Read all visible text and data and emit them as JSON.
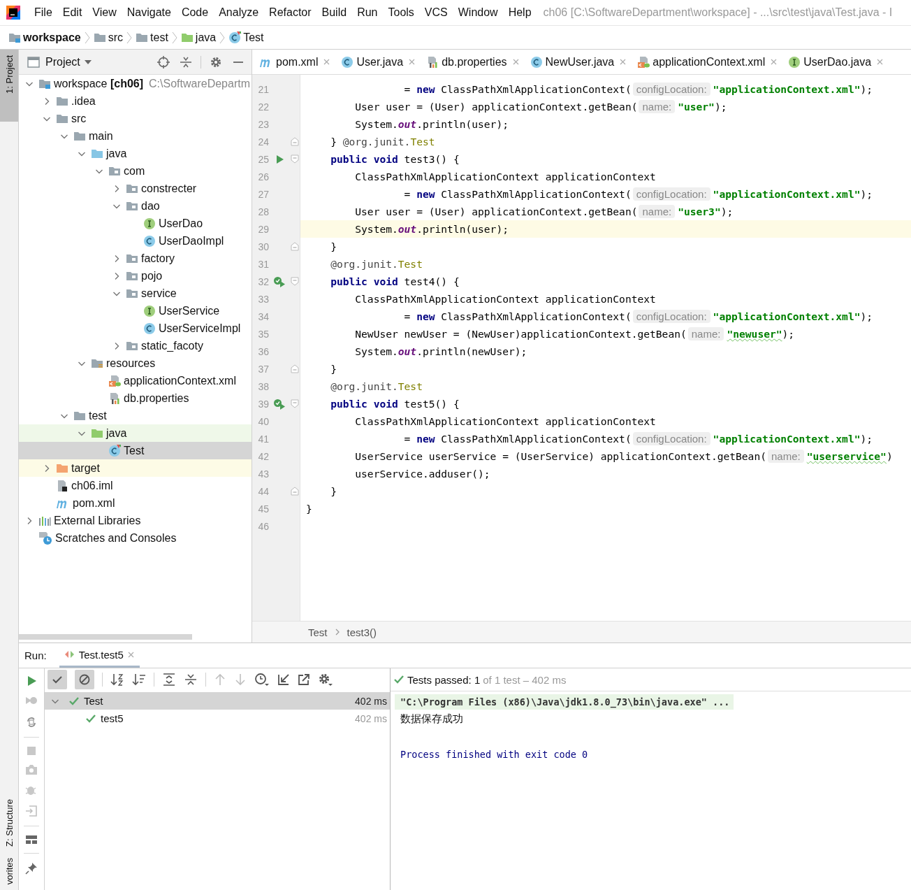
{
  "menu": [
    "File",
    "Edit",
    "View",
    "Navigate",
    "Code",
    "Analyze",
    "Refactor",
    "Build",
    "Run",
    "Tools",
    "VCS",
    "Window",
    "Help"
  ],
  "window_title": "ch06 [C:\\SoftwareDepartment\\workspace] - ...\\src\\test\\java\\Test.java - I",
  "navigation_bar": [
    {
      "label": "workspace",
      "kind": "module"
    },
    {
      "label": "src",
      "kind": "folder"
    },
    {
      "label": "test",
      "kind": "folder"
    },
    {
      "label": "java",
      "kind": "test-root"
    },
    {
      "label": "Test",
      "kind": "test-class"
    }
  ],
  "tool_strip": [
    {
      "label": "1: Project",
      "selected": true
    },
    {
      "label": "Z: Structure",
      "selected": false
    },
    {
      "label": "vorites",
      "selected": false
    }
  ],
  "project": {
    "title": "Project",
    "tree": [
      {
        "label": "workspace **[ch06]**",
        "path": "C:\\SoftwareDepartm",
        "kind": "module",
        "expanded": true,
        "selected": false,
        "children": [
          {
            "label": ".idea",
            "kind": "folder",
            "expanded": false,
            "selected": false
          },
          {
            "label": "src",
            "kind": "folder",
            "expanded": true,
            "selected": false,
            "children": [
              {
                "label": "main",
                "kind": "folder",
                "expanded": true,
                "selected": false,
                "children": [
                  {
                    "label": "java",
                    "kind": "source-root",
                    "expanded": true,
                    "selected": false,
                    "children": [
                      {
                        "label": "com",
                        "kind": "package",
                        "expanded": true,
                        "selected": false,
                        "children": [
                          {
                            "label": "constrecter",
                            "kind": "package",
                            "expanded": false,
                            "selected": false
                          },
                          {
                            "label": "dao",
                            "kind": "package",
                            "expanded": true,
                            "selected": false,
                            "children": [
                              {
                                "label": "UserDao",
                                "kind": "interface",
                                "selected": false
                              },
                              {
                                "label": "UserDaoImpl",
                                "kind": "class",
                                "selected": false
                              }
                            ]
                          },
                          {
                            "label": "factory",
                            "kind": "package",
                            "expanded": false,
                            "selected": false
                          },
                          {
                            "label": "pojo",
                            "kind": "package",
                            "expanded": false,
                            "selected": false
                          },
                          {
                            "label": "service",
                            "kind": "package",
                            "expanded": true,
                            "selected": false,
                            "children": [
                              {
                                "label": "UserService",
                                "kind": "interface",
                                "selected": false
                              },
                              {
                                "label": "UserServiceImpl",
                                "kind": "class",
                                "selected": false
                              }
                            ]
                          },
                          {
                            "label": "static_facoty",
                            "kind": "package",
                            "expanded": false,
                            "selected": false
                          }
                        ]
                      }
                    ]
                  },
                  {
                    "label": "resources",
                    "kind": "resources",
                    "expanded": true,
                    "selected": false,
                    "children": [
                      {
                        "label": "applicationContext.xml",
                        "kind": "xml-config",
                        "selected": false
                      },
                      {
                        "label": "db.properties",
                        "kind": "properties",
                        "selected": false
                      }
                    ]
                  }
                ]
              },
              {
                "label": "test",
                "kind": "folder",
                "expanded": true,
                "selected": false,
                "children": [
                  {
                    "label": "java",
                    "kind": "test-root",
                    "expanded": true,
                    "selected": false,
                    "color": "#eff8e9",
                    "children": [
                      {
                        "label": "Test",
                        "kind": "test-class",
                        "selected": true
                      }
                    ]
                  }
                ]
              }
            ]
          },
          {
            "label": "target",
            "kind": "excluded",
            "expanded": false,
            "selected": false,
            "color": "#fdfbe6"
          },
          {
            "label": "ch06.iml",
            "kind": "iml",
            "selected": false
          },
          {
            "label": "pom.xml",
            "kind": "maven",
            "selected": false
          }
        ]
      },
      {
        "label": "External Libraries",
        "kind": "libraries",
        "expanded": false,
        "selected": false
      },
      {
        "label": "Scratches and Consoles",
        "kind": "scratches",
        "selected": false
      }
    ]
  },
  "editor_tabs": [
    {
      "label": "pom.xml",
      "kind": "maven",
      "selected": false
    },
    {
      "label": "User.java",
      "kind": "class",
      "selected": false
    },
    {
      "label": "db.properties",
      "kind": "properties",
      "selected": false
    },
    {
      "label": "NewUser.java",
      "kind": "class",
      "selected": false
    },
    {
      "label": "applicationContext.xml",
      "kind": "xml-config",
      "selected": false
    },
    {
      "label": "UserDao.java",
      "kind": "interface",
      "selected": false
    }
  ],
  "code": [
    {
      "number": "21",
      "current": false,
      "tokens": [
        {
          "kind": "plain",
          "text": "                = "
        },
        {
          "kind": "keyword",
          "text": "new"
        },
        {
          "kind": "plain",
          "text": " ClassPathXmlApplicationContext("
        },
        {
          "kind": "hint",
          "text": "configLocation:"
        },
        {
          "kind": "string",
          "text": "\"applicationContext.xml\""
        },
        {
          "kind": "plain",
          "text": ");"
        }
      ]
    },
    {
      "number": "22",
      "current": false,
      "tokens": [
        {
          "kind": "plain",
          "text": "        User user = (User) applicationContext.getBean("
        },
        {
          "kind": "hint",
          "text": "name:"
        },
        {
          "kind": "string",
          "text": "\"user\""
        },
        {
          "kind": "plain",
          "text": ");"
        }
      ]
    },
    {
      "number": "23",
      "current": false,
      "tokens": [
        {
          "kind": "plain",
          "text": "        System."
        },
        {
          "kind": "field",
          "text": "out"
        },
        {
          "kind": "plain",
          "text": ".println(user);"
        }
      ]
    },
    {
      "number": "24",
      "current": false,
      "gutter_icons": [
        {
          "kind": "fold-end"
        }
      ],
      "tokens": [
        {
          "kind": "plain",
          "text": "    } "
        },
        {
          "kind": "annotation",
          "text": "@org.junit."
        },
        {
          "kind": "annotation-name",
          "text": "Test"
        }
      ]
    },
    {
      "number": "25",
      "current": false,
      "gutter_icons": [
        {
          "kind": "run"
        },
        {
          "kind": "fold-start"
        }
      ],
      "tokens": [
        {
          "kind": "keyword",
          "text": "    public"
        },
        {
          "kind": "keyword",
          "text": " void"
        },
        {
          "kind": "plain",
          "text": " test3() {"
        }
      ]
    },
    {
      "number": "26",
      "current": false,
      "tokens": [
        {
          "kind": "plain",
          "text": "        ClassPathXmlApplicationContext applicationContext"
        }
      ]
    },
    {
      "number": "27",
      "current": false,
      "tokens": [
        {
          "kind": "plain",
          "text": "                = "
        },
        {
          "kind": "keyword",
          "text": "new"
        },
        {
          "kind": "plain",
          "text": " ClassPathXmlApplicationContext("
        },
        {
          "kind": "hint",
          "text": "configLocation:"
        },
        {
          "kind": "string",
          "text": "\"applicationContext.xml\""
        },
        {
          "kind": "plain",
          "text": ");"
        }
      ]
    },
    {
      "number": "28",
      "current": false,
      "tokens": [
        {
          "kind": "plain",
          "text": "        User user = (User) applicationContext.getBean("
        },
        {
          "kind": "hint",
          "text": "name:"
        },
        {
          "kind": "string",
          "text": "\"user3\""
        },
        {
          "kind": "plain",
          "text": ");"
        }
      ]
    },
    {
      "number": "29",
      "current": true,
      "tokens": [
        {
          "kind": "plain",
          "text": "        System."
        },
        {
          "kind": "field",
          "text": "out"
        },
        {
          "kind": "plain",
          "text": ".println(user);"
        }
      ]
    },
    {
      "number": "30",
      "current": false,
      "gutter_icons": [
        {
          "kind": "fold-end"
        }
      ],
      "tokens": [
        {
          "kind": "plain",
          "text": "    }"
        }
      ]
    },
    {
      "number": "31",
      "current": false,
      "tokens": [
        {
          "kind": "annotation",
          "text": "    @org.junit."
        },
        {
          "kind": "annotation-name",
          "text": "Test"
        }
      ]
    },
    {
      "number": "32",
      "current": false,
      "gutter_icons": [
        {
          "kind": "run-passed"
        },
        {
          "kind": "fold-start"
        }
      ],
      "tokens": [
        {
          "kind": "keyword",
          "text": "    public"
        },
        {
          "kind": "keyword",
          "text": " void"
        },
        {
          "kind": "plain",
          "text": " test4() {"
        }
      ]
    },
    {
      "number": "33",
      "current": false,
      "tokens": [
        {
          "kind": "plain",
          "text": "        ClassPathXmlApplicationContext applicationContext"
        }
      ]
    },
    {
      "number": "34",
      "current": false,
      "tokens": [
        {
          "kind": "plain",
          "text": "                = "
        },
        {
          "kind": "keyword",
          "text": "new"
        },
        {
          "kind": "plain",
          "text": " ClassPathXmlApplicationContext("
        },
        {
          "kind": "hint",
          "text": "configLocation:"
        },
        {
          "kind": "string",
          "text": "\"applicationContext.xml\""
        },
        {
          "kind": "plain",
          "text": ");"
        }
      ]
    },
    {
      "number": "35",
      "current": false,
      "tokens": [
        {
          "kind": "plain",
          "text": "        NewUser newUser = (NewUser)applicationContext.getBean("
        },
        {
          "kind": "hint",
          "text": "name:"
        },
        {
          "kind": "string-typo",
          "text": "\"newuser\""
        },
        {
          "kind": "plain",
          "text": ");"
        }
      ]
    },
    {
      "number": "36",
      "current": false,
      "tokens": [
        {
          "kind": "plain",
          "text": "        System."
        },
        {
          "kind": "field",
          "text": "out"
        },
        {
          "kind": "plain",
          "text": ".println(newUser);"
        }
      ]
    },
    {
      "number": "37",
      "current": false,
      "gutter_icons": [
        {
          "kind": "fold-end"
        }
      ],
      "tokens": [
        {
          "kind": "plain",
          "text": "    }"
        }
      ]
    },
    {
      "number": "38",
      "current": false,
      "tokens": [
        {
          "kind": "annotation",
          "text": "    @org.junit."
        },
        {
          "kind": "annotation-name",
          "text": "Test"
        }
      ]
    },
    {
      "number": "39",
      "current": false,
      "gutter_icons": [
        {
          "kind": "run-passed"
        },
        {
          "kind": "fold-start"
        }
      ],
      "tokens": [
        {
          "kind": "keyword",
          "text": "    public"
        },
        {
          "kind": "keyword",
          "text": " void"
        },
        {
          "kind": "plain",
          "text": " test5() {"
        }
      ]
    },
    {
      "number": "40",
      "current": false,
      "tokens": [
        {
          "kind": "plain",
          "text": "        ClassPathXmlApplicationContext applicationContext"
        }
      ]
    },
    {
      "number": "41",
      "current": false,
      "tokens": [
        {
          "kind": "plain",
          "text": "                = "
        },
        {
          "kind": "keyword",
          "text": "new"
        },
        {
          "kind": "plain",
          "text": " ClassPathXmlApplicationContext("
        },
        {
          "kind": "hint",
          "text": "configLocation:"
        },
        {
          "kind": "string",
          "text": "\"applicationContext.xml\""
        },
        {
          "kind": "plain",
          "text": ");"
        }
      ]
    },
    {
      "number": "42",
      "current": false,
      "tokens": [
        {
          "kind": "plain",
          "text": "        UserService userService = (UserService) applicationContext.getBean("
        },
        {
          "kind": "hint",
          "text": "name:"
        },
        {
          "kind": "string-typo",
          "text": "\"userservice\""
        },
        {
          "kind": "plain",
          "text": ")"
        }
      ]
    },
    {
      "number": "43",
      "current": false,
      "tokens": [
        {
          "kind": "plain",
          "text": "        userService.adduser();"
        }
      ]
    },
    {
      "number": "44",
      "current": false,
      "gutter_icons": [
        {
          "kind": "fold-end"
        }
      ],
      "tokens": [
        {
          "kind": "plain",
          "text": "    }"
        }
      ]
    },
    {
      "number": "45",
      "current": false,
      "tokens": [
        {
          "kind": "plain",
          "text": "}"
        }
      ]
    },
    {
      "number": "46",
      "current": false
    }
  ],
  "editor_breadcrumbs": [
    "Test",
    "test3()"
  ],
  "run": {
    "label": "Run:",
    "tab": {
      "label": "Test.test5",
      "selected": true
    },
    "toggles": [
      {
        "on": true
      },
      {
        "on": true
      }
    ],
    "status": {
      "main": "Tests passed: 1",
      "detail": "of 1 test – 402 ms"
    },
    "tests": [
      {
        "label": "Test",
        "time": "402 ms",
        "expanded": true,
        "selected": true,
        "children": [
          {
            "label": "test5",
            "time": "402 ms",
            "selected": false
          }
        ]
      }
    ],
    "console": [
      {
        "kind": "command",
        "text": "\"C:\\Program Files (x86)\\Java\\jdk1.8.0_73\\bin\\java.exe\" ..."
      },
      {
        "kind": "output",
        "text": "数据保存成功"
      },
      {
        "kind": "blank"
      },
      {
        "kind": "exit",
        "text": "Process finished with exit code 0"
      }
    ]
  }
}
